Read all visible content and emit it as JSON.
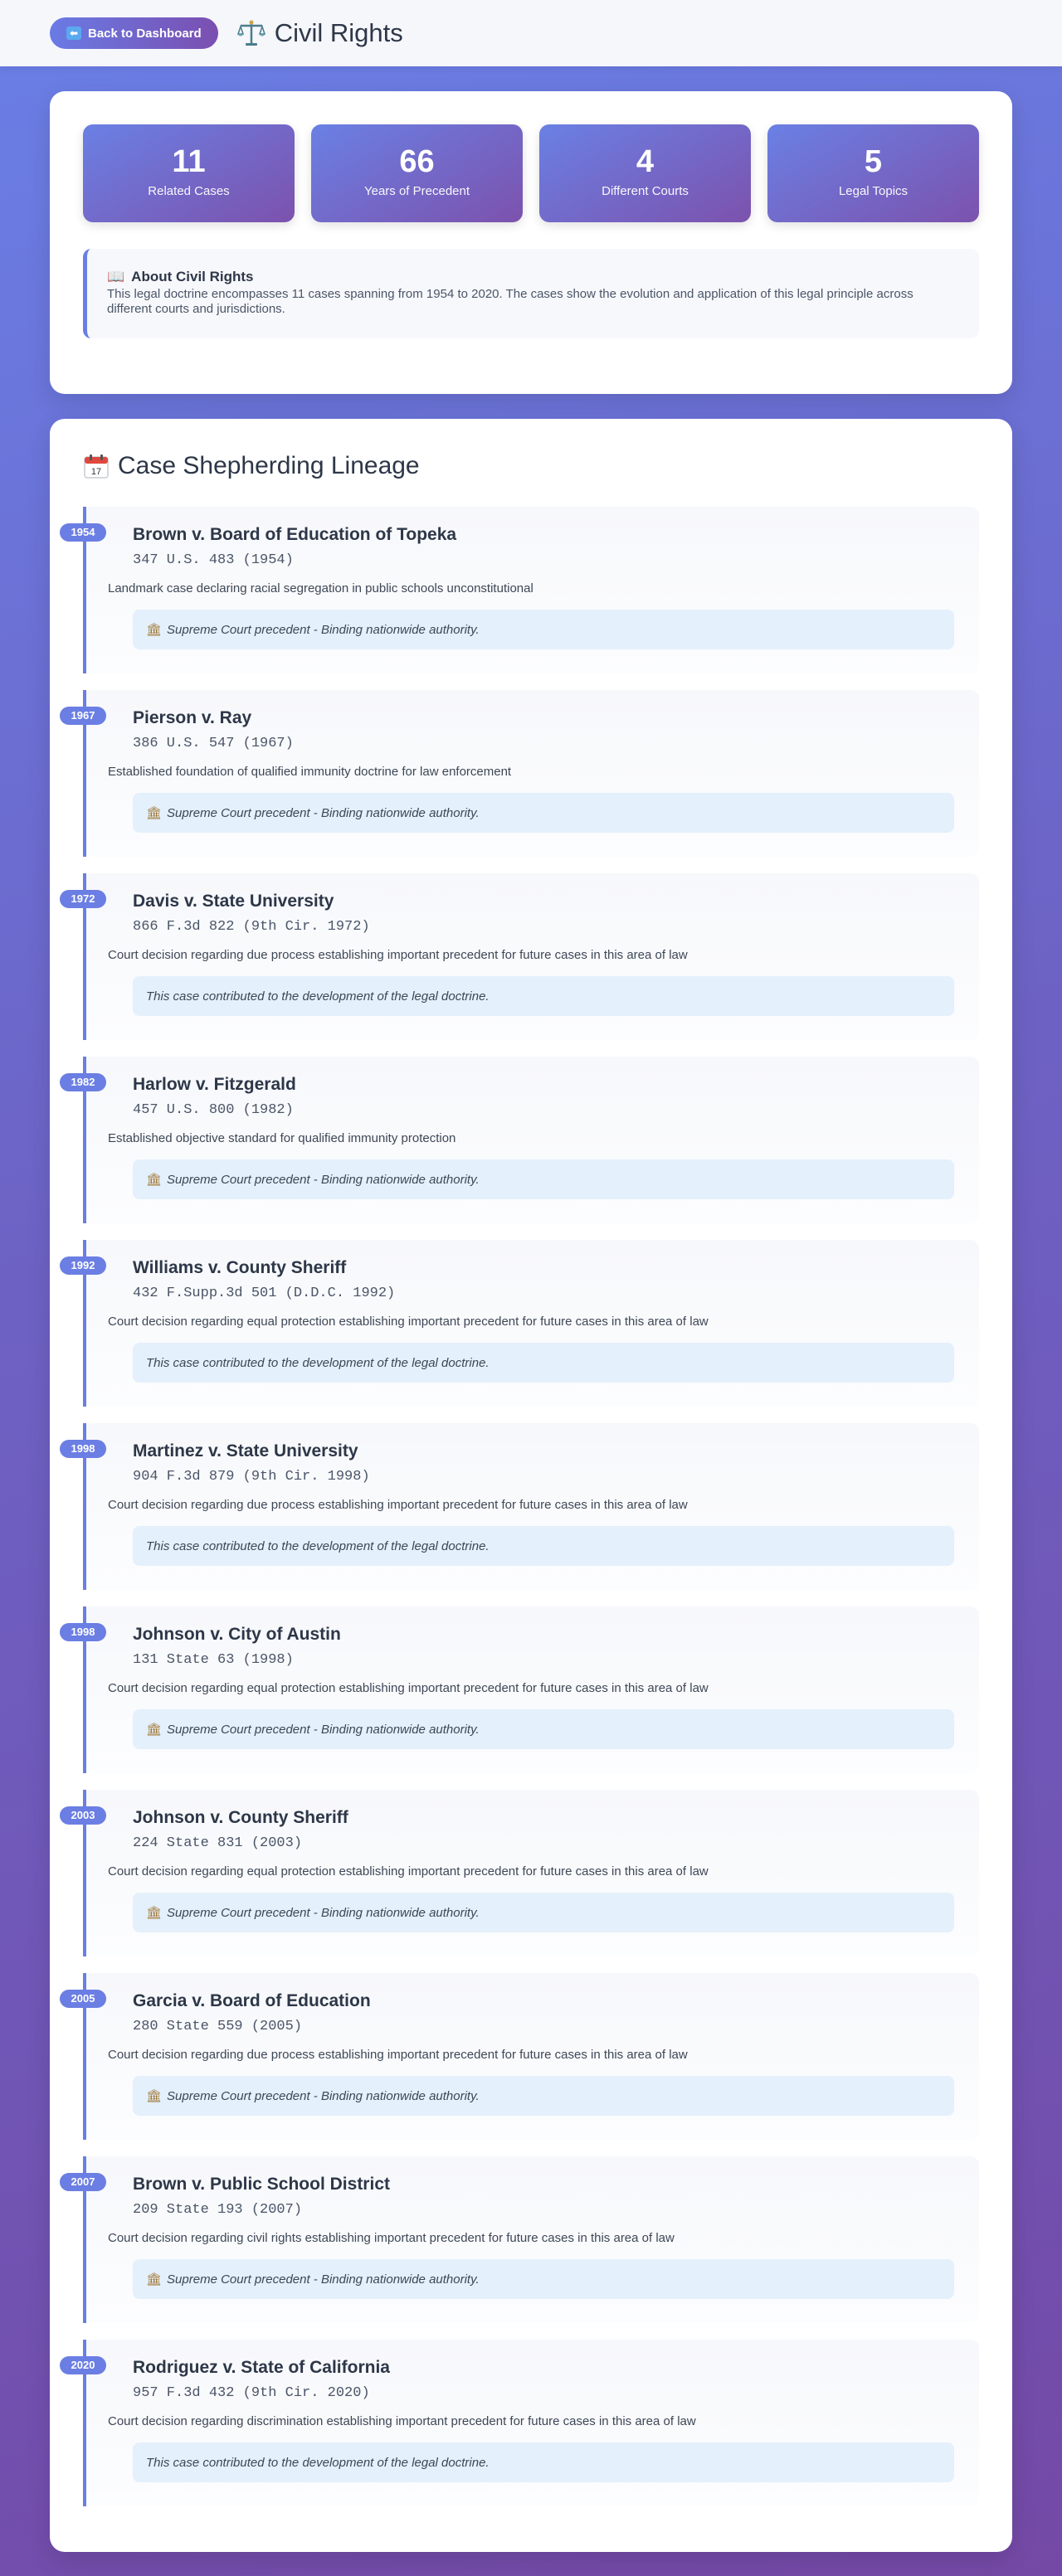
{
  "header": {
    "back_label": "Back to Dashboard",
    "title": "Civil Rights"
  },
  "stats": [
    {
      "value": "11",
      "label": "Related Cases"
    },
    {
      "value": "66",
      "label": "Years of Precedent"
    },
    {
      "value": "4",
      "label": "Different Courts"
    },
    {
      "value": "5",
      "label": "Legal Topics"
    }
  ],
  "about": {
    "title": "About Civil Rights",
    "text": "This legal doctrine encompasses 11 cases spanning from 1954 to 2020. The cases show the evolution and application of this legal principle across different courts and jurisdictions."
  },
  "lineage": {
    "title": "Case Shepherding Lineage",
    "cases": [
      {
        "year": "1954",
        "name": "Brown v. Board of Education of Topeka",
        "citation": "347 U.S. 483 (1954)",
        "description": "Landmark case declaring racial segregation in public schools unconstitutional",
        "note": "Supreme Court precedent - Binding nationwide authority.",
        "supreme": true
      },
      {
        "year": "1967",
        "name": "Pierson v. Ray",
        "citation": "386 U.S. 547 (1967)",
        "description": "Established foundation of qualified immunity doctrine for law enforcement",
        "note": "Supreme Court precedent - Binding nationwide authority.",
        "supreme": true
      },
      {
        "year": "1972",
        "name": "Davis v. State University",
        "citation": "866 F.3d 822 (9th Cir. 1972)",
        "description": "Court decision regarding due process establishing important precedent for future cases in this area of law",
        "note": "This case contributed to the development of the legal doctrine.",
        "supreme": false
      },
      {
        "year": "1982",
        "name": "Harlow v. Fitzgerald",
        "citation": "457 U.S. 800 (1982)",
        "description": "Established objective standard for qualified immunity protection",
        "note": "Supreme Court precedent - Binding nationwide authority.",
        "supreme": true
      },
      {
        "year": "1992",
        "name": "Williams v. County Sheriff",
        "citation": "432 F.Supp.3d 501 (D.D.C. 1992)",
        "description": "Court decision regarding equal protection establishing important precedent for future cases in this area of law",
        "note": "This case contributed to the development of the legal doctrine.",
        "supreme": false
      },
      {
        "year": "1998",
        "name": "Martinez v. State University",
        "citation": "904 F.3d 879 (9th Cir. 1998)",
        "description": "Court decision regarding due process establishing important precedent for future cases in this area of law",
        "note": "This case contributed to the development of the legal doctrine.",
        "supreme": false
      },
      {
        "year": "1998",
        "name": "Johnson v. City of Austin",
        "citation": "131 State 63 (1998)",
        "description": "Court decision regarding equal protection establishing important precedent for future cases in this area of law",
        "note": "Supreme Court precedent - Binding nationwide authority.",
        "supreme": true
      },
      {
        "year": "2003",
        "name": "Johnson v. County Sheriff",
        "citation": "224 State 831 (2003)",
        "description": "Court decision regarding equal protection establishing important precedent for future cases in this area of law",
        "note": "Supreme Court precedent - Binding nationwide authority.",
        "supreme": true
      },
      {
        "year": "2005",
        "name": "Garcia v. Board of Education",
        "citation": "280 State 559 (2005)",
        "description": "Court decision regarding due process establishing important precedent for future cases in this area of law",
        "note": "Supreme Court precedent - Binding nationwide authority.",
        "supreme": true
      },
      {
        "year": "2007",
        "name": "Brown v. Public School District",
        "citation": "209 State 193 (2007)",
        "description": "Court decision regarding civil rights establishing important precedent for future cases in this area of law",
        "note": "Supreme Court precedent - Binding nationwide authority.",
        "supreme": true
      },
      {
        "year": "2020",
        "name": "Rodriguez v. State of California",
        "citation": "957 F.3d 432 (9th Cir. 2020)",
        "description": "Court decision regarding discrimination establishing important precedent for future cases in this area of law",
        "note": "This case contributed to the development of the legal doctrine.",
        "supreme": false
      }
    ]
  },
  "colors": {
    "accent": "#6b7ee3",
    "accent_purple": "#7a4fb0",
    "note_bg": "#e4f0fb"
  },
  "icons": {
    "back": "back-arrow-icon",
    "title": "scales-icon",
    "about": "book-icon",
    "lineage": "calendar-icon",
    "supreme": "courthouse-icon"
  }
}
